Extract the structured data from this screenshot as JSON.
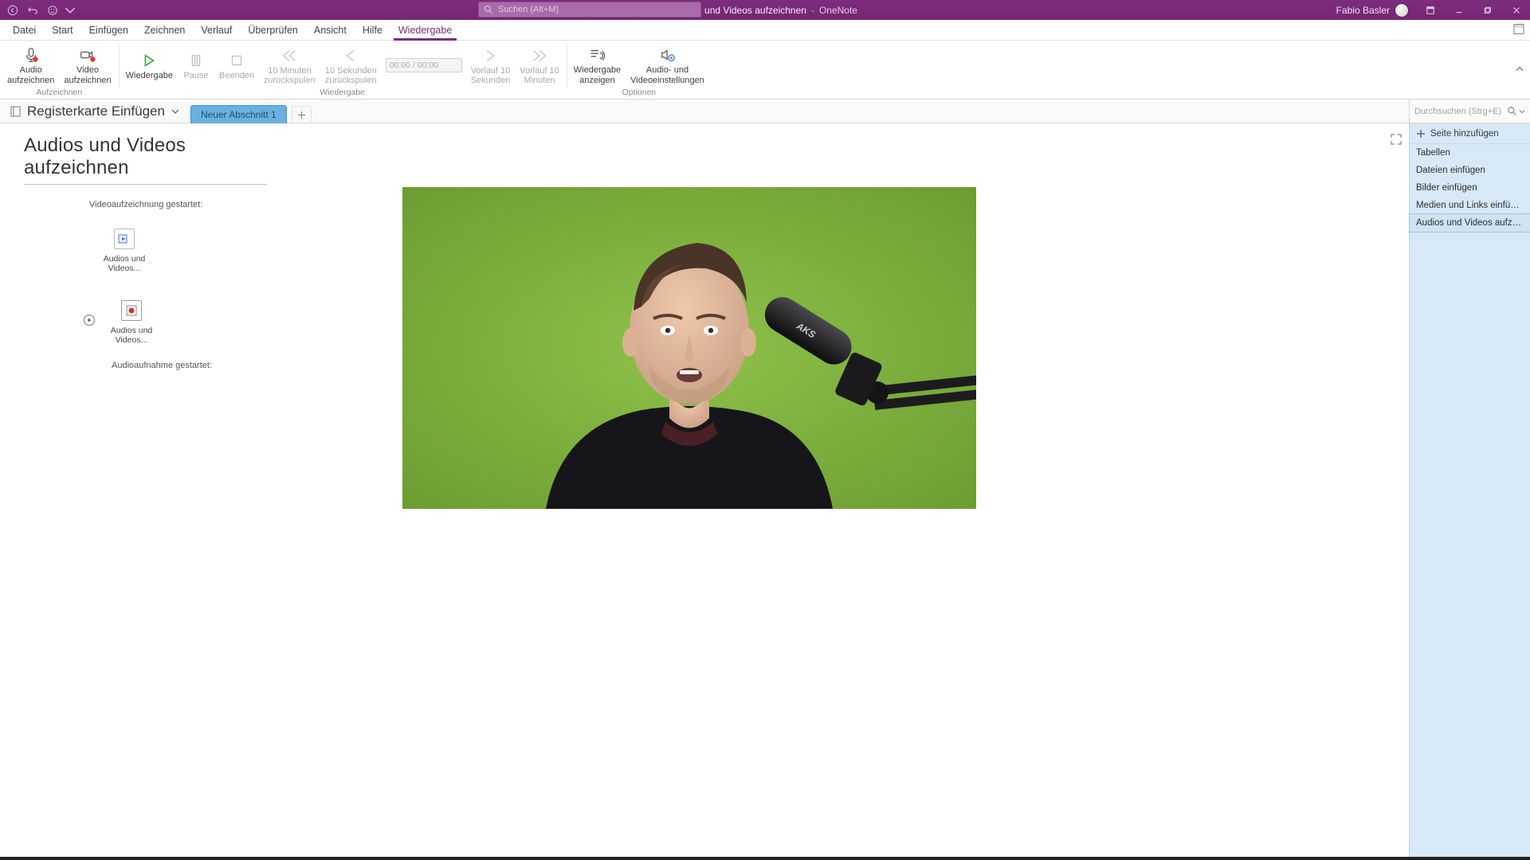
{
  "titlebar": {
    "doc_title": "Audios und Videos aufzeichnen",
    "app_name": "OneNote",
    "search_placeholder": "Suchen (Alt+M)",
    "user_name": "Fabio Basler"
  },
  "tabs": {
    "items": [
      {
        "label": "Datei"
      },
      {
        "label": "Start"
      },
      {
        "label": "Einfügen"
      },
      {
        "label": "Zeichnen"
      },
      {
        "label": "Verlauf"
      },
      {
        "label": "Überprüfen"
      },
      {
        "label": "Ansicht"
      },
      {
        "label": "Hilfe"
      },
      {
        "label": "Wiedergabe",
        "active": true
      }
    ]
  },
  "ribbon": {
    "groups": [
      {
        "label": "Aufzeichnen",
        "buttons": [
          {
            "label": "Audio\naufzeichnen",
            "icon": "mic-record",
            "enabled": true
          },
          {
            "label": "Video\naufzeichnen",
            "icon": "video-record",
            "enabled": true
          }
        ]
      },
      {
        "label": "Wiedergabe",
        "buttons": [
          {
            "label": "Wiedergabe",
            "icon": "play",
            "enabled": true
          },
          {
            "label": "Pause",
            "icon": "pause",
            "enabled": false
          },
          {
            "label": "Beenden",
            "icon": "stop",
            "enabled": false
          },
          {
            "label": "10 Minuten\nzurückspulen",
            "icon": "rewind-10m",
            "enabled": false
          },
          {
            "label": "10 Sekunden\nzurückspulen",
            "icon": "rewind-10s",
            "enabled": false
          }
        ],
        "timecode": "00:00 / 00:00",
        "buttons2": [
          {
            "label": "Vorlauf 10\nSekunden",
            "icon": "forward-10s",
            "enabled": false
          },
          {
            "label": "Vorlauf 10\nMinuten",
            "icon": "forward-10m",
            "enabled": false
          }
        ]
      },
      {
        "label": "Optionen",
        "buttons": [
          {
            "label": "Wiedergabe\nanzeigen",
            "icon": "see-playback",
            "enabled": true
          },
          {
            "label": "Audio- und\nVideoeinstellungen",
            "icon": "av-settings",
            "enabled": true
          }
        ]
      }
    ]
  },
  "notebook": {
    "name": "Registerkarte Einfügen",
    "section": "Neuer Abschnitt 1",
    "page_search_placeholder": "Durchsuchen (Strg+E)"
  },
  "page": {
    "title": "Audios und Videos aufzeichnen",
    "note_video_started": "Videoaufzeichnung gestartet:",
    "note_audio_started": "Audioaufnahme gestartet:",
    "file1_label": "Audios und\nVideos...",
    "file2_label": "Audios und\nVideos..."
  },
  "pagepanel": {
    "add_page": "Seite hinzufügen",
    "items": [
      {
        "label": "Tabellen"
      },
      {
        "label": "Dateien einfügen"
      },
      {
        "label": "Bilder einfügen"
      },
      {
        "label": "Medien und Links einfügen"
      },
      {
        "label": "Audios und Videos aufzeichnen",
        "selected": true
      }
    ]
  },
  "colors": {
    "accent": "#7d2b7d",
    "section_tab": "#69b1e0",
    "page_panel": "#d7e8f7"
  }
}
